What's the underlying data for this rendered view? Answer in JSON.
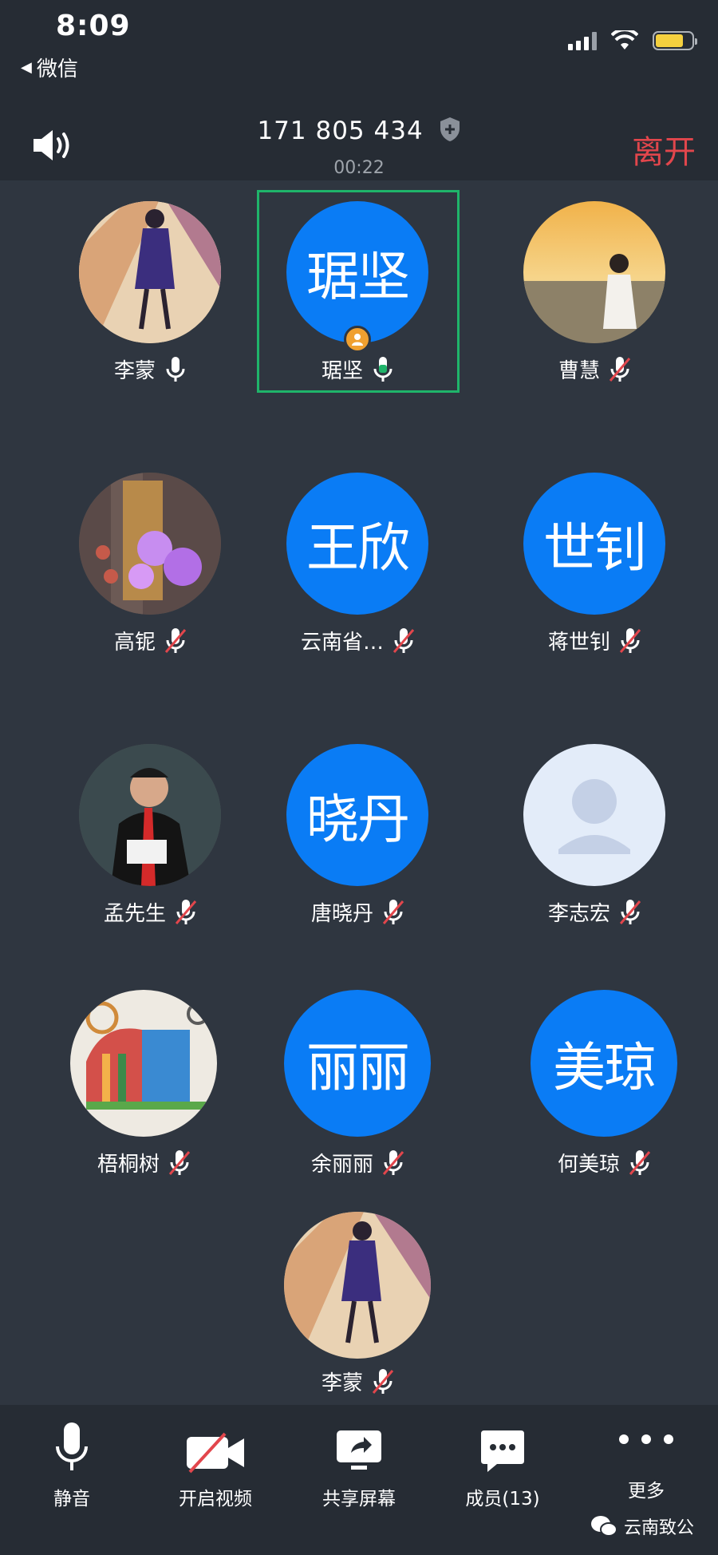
{
  "status_bar": {
    "time": "8:09",
    "back_app": "微信"
  },
  "header": {
    "meeting_id": "171 805 434",
    "timer": "00:22",
    "leave_label": "离开"
  },
  "participants": [
    {
      "name": "李蒙",
      "avatar_type": "photo",
      "mic": "on"
    },
    {
      "name": "琚坚",
      "avatar_text": "琚坚",
      "avatar_type": "text",
      "mic": "on_active",
      "host": true,
      "selected": true
    },
    {
      "name": "曹慧",
      "avatar_type": "photo",
      "mic": "muted"
    },
    {
      "name": "高铌",
      "avatar_type": "photo",
      "mic": "muted"
    },
    {
      "name": "云南省…",
      "avatar_text": "王欣",
      "avatar_type": "text",
      "mic": "muted"
    },
    {
      "name": "蒋世钊",
      "avatar_text": "世钊",
      "avatar_type": "text",
      "mic": "muted"
    },
    {
      "name": "孟先生",
      "avatar_type": "photo",
      "mic": "muted"
    },
    {
      "name": "唐晓丹",
      "avatar_text": "晓丹",
      "avatar_type": "text",
      "mic": "muted"
    },
    {
      "name": "李志宏",
      "avatar_type": "default",
      "mic": "muted"
    },
    {
      "name": "梧桐树",
      "avatar_type": "photo",
      "mic": "muted"
    },
    {
      "name": "余丽丽",
      "avatar_text": "丽丽",
      "avatar_type": "text",
      "mic": "muted"
    },
    {
      "name": "何美琼",
      "avatar_text": "美琼",
      "avatar_type": "text",
      "mic": "muted"
    },
    {
      "name": "李蒙",
      "avatar_type": "photo",
      "mic": "muted"
    }
  ],
  "toolbar": {
    "mute_label": "静音",
    "video_label": "开启视频",
    "share_label": "共享屏幕",
    "members_label": "成员(13)",
    "more_label": "更多"
  },
  "watermark": {
    "text": "云南致公"
  },
  "colors": {
    "accent_blue": "#0a7cf5",
    "leave_red": "#e2464c",
    "host_badge": "#f0a030",
    "active_mic": "#1fb46a",
    "selection": "#1fb46a"
  }
}
